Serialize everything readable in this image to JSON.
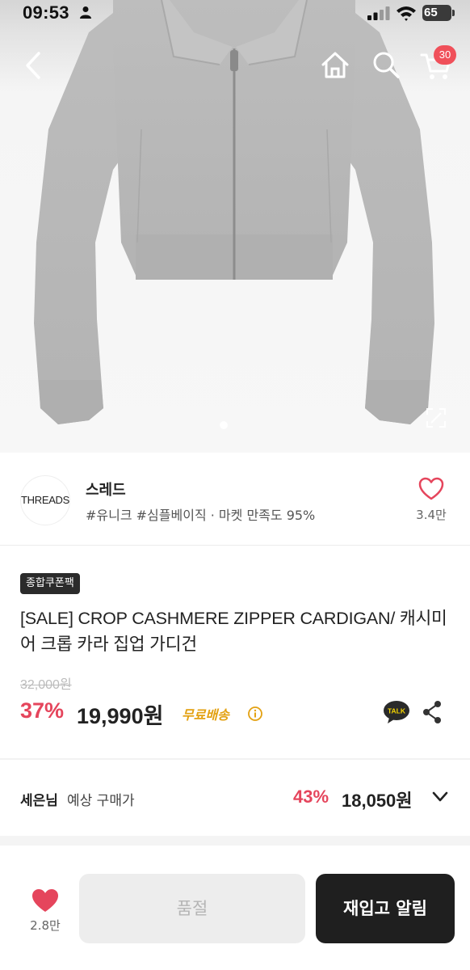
{
  "status_bar": {
    "time": "09:53",
    "battery": "65"
  },
  "nav": {
    "cart_count": "30"
  },
  "shop": {
    "logo_text": "THREADS",
    "name": "스레드",
    "tags": "#유니크 #심플베이직 · 마켓 만족도 95%",
    "like_count": "3.4만"
  },
  "product": {
    "coupon_badge": "종합쿠폰팩",
    "title": "[SALE] CROP CASHMERE ZIPPER CARDIGAN/ 캐시미어 크롭 카라 집업 가디건",
    "original_price": "32,000원",
    "discount": "37%",
    "price": "19,990원",
    "shipping": "무료배송"
  },
  "expected": {
    "user_name": "세은님",
    "label": "예상 구매가",
    "discount": "43%",
    "price": "18,050원"
  },
  "bottom_bar": {
    "like_count": "2.8만",
    "soldout_label": "품절",
    "restock_label": "재입고 알림"
  },
  "colors": {
    "accent_red": "#e5455c",
    "shipping_yellow": "#e3a112",
    "dark_button": "#1f1f1f"
  },
  "icons": [
    "person-icon",
    "signal-icon",
    "wifi-icon",
    "back-icon",
    "home-icon",
    "search-icon",
    "cart-icon",
    "expand-icon",
    "heart-outline-icon",
    "info-icon",
    "kakao-talk-icon",
    "share-icon",
    "chevron-down-icon",
    "heart-filled-icon"
  ]
}
